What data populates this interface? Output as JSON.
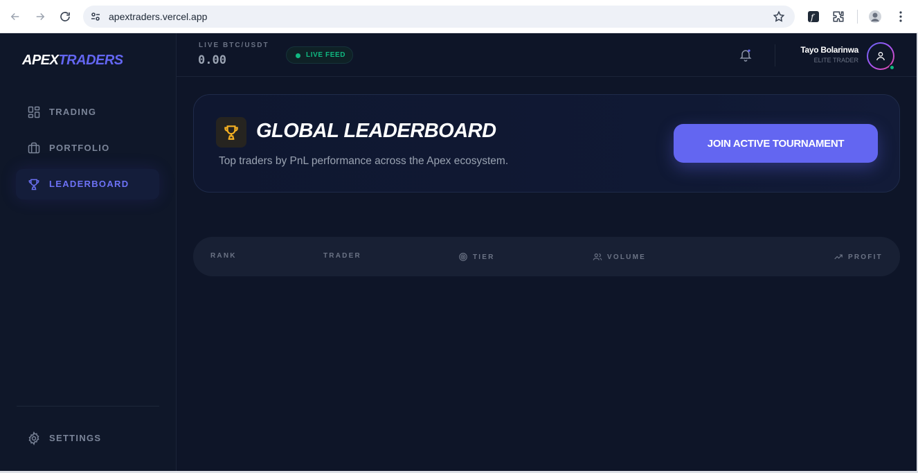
{
  "browser": {
    "url": "apextraders.vercel.app"
  },
  "brand": {
    "name_part1": "APEX",
    "name_part2": "TRADERS",
    "accent": "#6366f1"
  },
  "sidebar": {
    "items": [
      {
        "label": "TRADING",
        "icon": "grid-icon"
      },
      {
        "label": "PORTFOLIO",
        "icon": "briefcase-icon"
      },
      {
        "label": "LEADERBOARD",
        "icon": "trophy-icon",
        "active": true
      }
    ],
    "settings_label": "SETTINGS"
  },
  "header": {
    "ticker_label": "LIVE BTC/USDT",
    "ticker_value": "0.00",
    "live_label": "LIVE FEED",
    "user_name": "Tayo Bolarinwa",
    "user_role": "ELITE TRADER"
  },
  "hero": {
    "title": "GLOBAL LEADERBOARD",
    "subtitle": "Top traders by PnL performance across the Apex ecosystem.",
    "cta": "JOIN ACTIVE TOURNAMENT"
  },
  "table": {
    "columns": [
      "RANK",
      "TRADER",
      "TIER",
      "VOLUME",
      "PROFIT"
    ]
  },
  "colors": {
    "background": "#0e1528",
    "live_green": "#10b981",
    "trophy_gold": "#f5b022"
  }
}
